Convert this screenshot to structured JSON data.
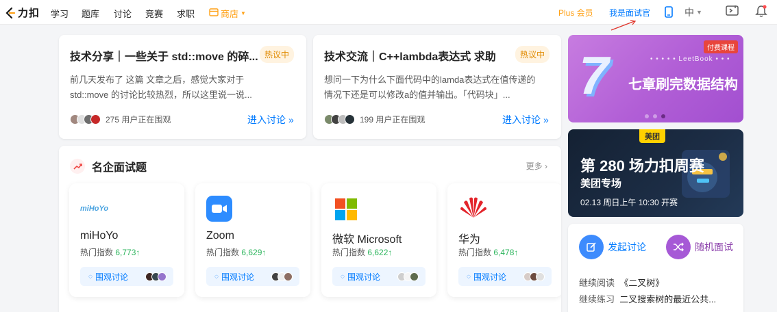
{
  "nav": {
    "logo_text": "力扣",
    "items": [
      "学习",
      "题库",
      "讨论",
      "竞赛",
      "求职"
    ],
    "shop": "商店",
    "plus": "Plus 会员",
    "interviewer": "我是面试官",
    "lang": "中"
  },
  "discussions": [
    {
      "title": "技术分享｜一些关于 std::move 的碎...",
      "badge": "热议中",
      "body": "前几天发布了 这篇 文章之后，感觉大家对于 std::move 的讨论比较热烈，所以这里说一说...",
      "viewers": "275 用户正在围观",
      "enter": "进入讨论"
    },
    {
      "title": "技术交流｜C++lambda表达式 求助",
      "badge": "热议中",
      "body": "想问一下为什么下面代码中的lamda表达式在值传递的情况下还是可以修改a的值并输出。「代码块」...",
      "viewers": "199 用户正在围观",
      "enter": "进入讨论"
    }
  ],
  "companies_section": {
    "title": "名企面试题",
    "more": "更多",
    "companies": [
      {
        "name": "miHoYo",
        "index_label": "热门指数",
        "index_value": "6,773↑",
        "watch": "围观讨论",
        "logo_text": "miHoYo"
      },
      {
        "name": "Zoom",
        "index_label": "热门指数",
        "index_value": "6,629↑",
        "watch": "围观讨论"
      },
      {
        "name": "微软 Microsoft",
        "index_label": "热门指数",
        "index_value": "6,622↑",
        "watch": "围观讨论"
      },
      {
        "name": "华为",
        "index_label": "热门指数",
        "index_value": "6,478↑",
        "watch": "围观讨论"
      }
    ]
  },
  "banner1": {
    "tag": "付费课程",
    "brand": "LeetBook",
    "big_number": "7",
    "title": "七章刷完数据结构"
  },
  "banner2": {
    "brand": "美团",
    "title": "第 280 场力扣周赛",
    "subtitle": "美团专场",
    "time": "02.13 周日上午 10:30 开赛"
  },
  "actions": {
    "start": "发起讨论",
    "random": "随机面试",
    "read_label": "继续阅读",
    "read_value": "《二叉树》",
    "practice_label": "继续练习",
    "practice_value": "二叉搜索树的最近公共..."
  },
  "colors": {
    "accent": "#007aff",
    "orange": "#ffa116",
    "green": "#2db55d"
  }
}
